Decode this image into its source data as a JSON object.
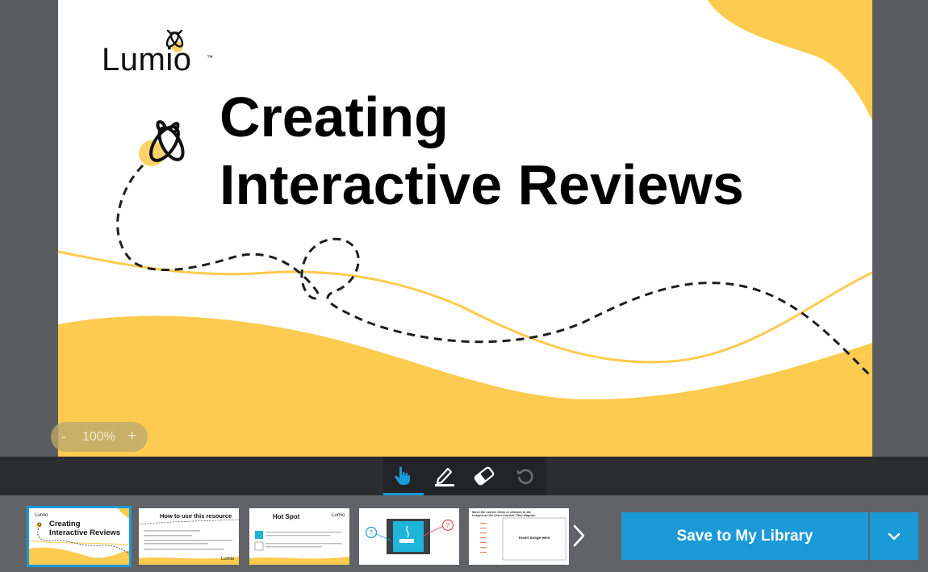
{
  "slide": {
    "brand": "Lumio",
    "brand_tm": "™",
    "title_line1": "Creating",
    "title_line2": "Interactive Reviews",
    "accent_color": "#fdcb4f"
  },
  "zoom": {
    "minus": "-",
    "value": "100%",
    "plus": "+"
  },
  "toolbar": {
    "tools": [
      {
        "icon": "pointer-hand-icon",
        "active": true
      },
      {
        "icon": "pen-icon",
        "active": false
      },
      {
        "icon": "eraser-icon",
        "active": false
      },
      {
        "icon": "undo-icon",
        "active": false
      }
    ],
    "highlight_color": "#1a9ad6"
  },
  "thumbnails": [
    {
      "title_line1": "Creating",
      "title_line2": "Interactive Reviews",
      "brand": "Lumio",
      "selected": true
    },
    {
      "title": "How to use this resource",
      "brand": "Lumio"
    },
    {
      "title": "Hot Spot",
      "brand": "Lumio"
    },
    {
      "title": ""
    },
    {
      "heading": "Move the correct items or phrases to the hotspot on the (Your Content Title) diagram.",
      "placeholder": "Insert Image Here"
    }
  ],
  "actions": {
    "save_label": "Save to My Library",
    "dropdown_icon": "chevron-down-icon"
  }
}
